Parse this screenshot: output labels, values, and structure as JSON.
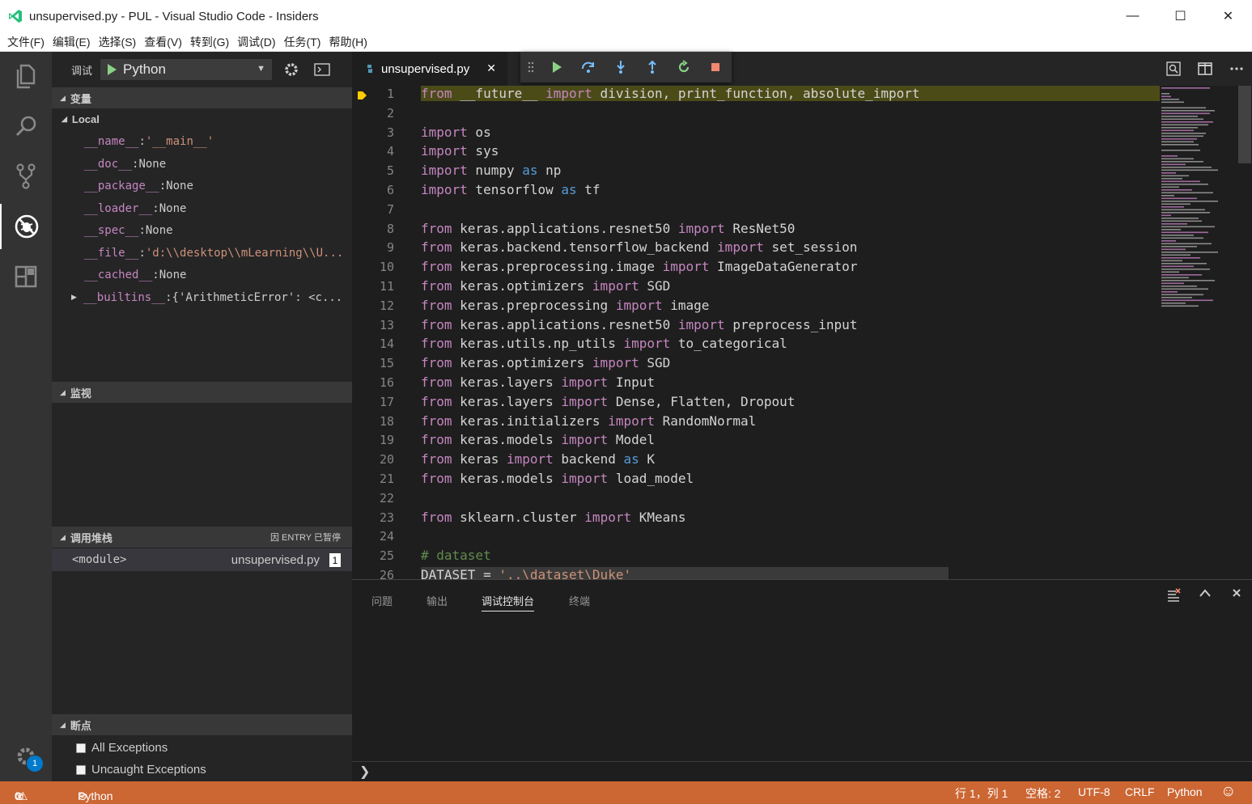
{
  "window": {
    "title": "unsupervised.py - PUL - Visual Studio Code - Insiders",
    "minimize": "—",
    "maximize": "☐",
    "close": "✕"
  },
  "menu": [
    "文件(F)",
    "编辑(E)",
    "选择(S)",
    "查看(V)",
    "转到(G)",
    "调试(D)",
    "任务(T)",
    "帮助(H)"
  ],
  "activity_bar": {
    "icons": [
      "files-icon",
      "search-icon",
      "source-control-icon",
      "debug-icon",
      "extensions-icon",
      "settings-gear-icon"
    ],
    "settings_badge": "1"
  },
  "debug": {
    "label": "调试",
    "configuration": "Python",
    "sections": {
      "variables": "变量",
      "watch": "监视",
      "callstack": "调用堆栈",
      "breakpoints": "断点"
    },
    "scope": "Local",
    "variables": [
      {
        "name": "__name__",
        "value": "'__main__'",
        "is_string": true
      },
      {
        "name": "__doc__",
        "value": "None",
        "is_string": false
      },
      {
        "name": "__package__",
        "value": "None",
        "is_string": false
      },
      {
        "name": "__loader__",
        "value": "None",
        "is_string": false
      },
      {
        "name": "__spec__",
        "value": "None",
        "is_string": false
      },
      {
        "name": "__file__",
        "value": "'d:\\\\desktop\\\\mLearning\\\\U...",
        "is_string": true
      },
      {
        "name": "__cached__",
        "value": "None",
        "is_string": false
      },
      {
        "name": "__builtins__",
        "value": "{'ArithmeticError': <c...",
        "is_string": false
      }
    ],
    "callstack_status": "因 ENTRY 已暂停",
    "callstack_frame": {
      "name": "<module>",
      "file": "unsupervised.py",
      "line": "1"
    },
    "breakpoints": [
      {
        "label": "All Exceptions"
      },
      {
        "label": "Uncaught Exceptions"
      }
    ]
  },
  "editor": {
    "tab": "unsupervised.py",
    "lines": [
      {
        "n": "1",
        "tokens": [
          [
            "from",
            "kw"
          ],
          [
            " __future__ ",
            ""
          ],
          [
            "import",
            "kw"
          ],
          [
            " division, print_function, absolute_import",
            ""
          ]
        ],
        "highlight": true
      },
      {
        "n": "2",
        "tokens": []
      },
      {
        "n": "3",
        "tokens": [
          [
            "import",
            "kw"
          ],
          [
            " os",
            ""
          ]
        ]
      },
      {
        "n": "4",
        "tokens": [
          [
            "import",
            "kw"
          ],
          [
            " sys",
            ""
          ]
        ]
      },
      {
        "n": "5",
        "tokens": [
          [
            "import",
            "kw"
          ],
          [
            " numpy ",
            ""
          ],
          [
            "as",
            "kw2"
          ],
          [
            " np",
            ""
          ]
        ]
      },
      {
        "n": "6",
        "tokens": [
          [
            "import",
            "kw"
          ],
          [
            " tensorflow ",
            ""
          ],
          [
            "as",
            "kw2"
          ],
          [
            " tf",
            ""
          ]
        ]
      },
      {
        "n": "7",
        "tokens": []
      },
      {
        "n": "8",
        "tokens": [
          [
            "from",
            "kw"
          ],
          [
            " keras.applications.resnet50 ",
            ""
          ],
          [
            "import",
            "kw"
          ],
          [
            " ResNet50",
            ""
          ]
        ]
      },
      {
        "n": "9",
        "tokens": [
          [
            "from",
            "kw"
          ],
          [
            " keras.backend.tensorflow_backend ",
            ""
          ],
          [
            "import",
            "kw"
          ],
          [
            " set_session",
            ""
          ]
        ]
      },
      {
        "n": "10",
        "tokens": [
          [
            "from",
            "kw"
          ],
          [
            " keras.preprocessing.image ",
            ""
          ],
          [
            "import",
            "kw"
          ],
          [
            " ImageDataGenerator",
            ""
          ]
        ]
      },
      {
        "n": "11",
        "tokens": [
          [
            "from",
            "kw"
          ],
          [
            " keras.optimizers ",
            ""
          ],
          [
            "import",
            "kw"
          ],
          [
            " SGD",
            ""
          ]
        ]
      },
      {
        "n": "12",
        "tokens": [
          [
            "from",
            "kw"
          ],
          [
            " keras.preprocessing ",
            ""
          ],
          [
            "import",
            "kw"
          ],
          [
            " image",
            ""
          ]
        ]
      },
      {
        "n": "13",
        "tokens": [
          [
            "from",
            "kw"
          ],
          [
            " keras.applications.resnet50 ",
            ""
          ],
          [
            "import",
            "kw"
          ],
          [
            " preprocess_input",
            ""
          ]
        ]
      },
      {
        "n": "14",
        "tokens": [
          [
            "from",
            "kw"
          ],
          [
            " keras.utils.np_utils ",
            ""
          ],
          [
            "import",
            "kw"
          ],
          [
            " to_categorical",
            ""
          ]
        ]
      },
      {
        "n": "15",
        "tokens": [
          [
            "from",
            "kw"
          ],
          [
            " keras.optimizers ",
            ""
          ],
          [
            "import",
            "kw"
          ],
          [
            " SGD",
            ""
          ]
        ]
      },
      {
        "n": "16",
        "tokens": [
          [
            "from",
            "kw"
          ],
          [
            " keras.layers ",
            ""
          ],
          [
            "import",
            "kw"
          ],
          [
            " Input",
            ""
          ]
        ]
      },
      {
        "n": "17",
        "tokens": [
          [
            "from",
            "kw"
          ],
          [
            " keras.layers ",
            ""
          ],
          [
            "import",
            "kw"
          ],
          [
            " Dense, Flatten, Dropout",
            ""
          ]
        ]
      },
      {
        "n": "18",
        "tokens": [
          [
            "from",
            "kw"
          ],
          [
            " keras.initializers ",
            ""
          ],
          [
            "import",
            "kw"
          ],
          [
            " RandomNormal",
            ""
          ]
        ]
      },
      {
        "n": "19",
        "tokens": [
          [
            "from",
            "kw"
          ],
          [
            " keras.models ",
            ""
          ],
          [
            "import",
            "kw"
          ],
          [
            " Model",
            ""
          ]
        ]
      },
      {
        "n": "20",
        "tokens": [
          [
            "from",
            "kw"
          ],
          [
            " keras ",
            ""
          ],
          [
            "import",
            "kw"
          ],
          [
            " backend ",
            ""
          ],
          [
            "as",
            "kw2"
          ],
          [
            " K",
            ""
          ]
        ]
      },
      {
        "n": "21",
        "tokens": [
          [
            "from",
            "kw"
          ],
          [
            " keras.models ",
            ""
          ],
          [
            "import",
            "kw"
          ],
          [
            " load_model",
            ""
          ]
        ]
      },
      {
        "n": "22",
        "tokens": []
      },
      {
        "n": "23",
        "tokens": [
          [
            "from",
            "kw"
          ],
          [
            " sklearn.cluster ",
            ""
          ],
          [
            "import",
            "kw"
          ],
          [
            " KMeans",
            ""
          ]
        ]
      },
      {
        "n": "24",
        "tokens": []
      },
      {
        "n": "25",
        "tokens": [
          [
            "# dataset",
            "cm"
          ]
        ]
      },
      {
        "n": "26",
        "tokens": [
          [
            "DATASET = ",
            ""
          ],
          [
            "'..\\dataset\\Duke'",
            "str"
          ]
        ]
      }
    ]
  },
  "panel": {
    "tabs": [
      "问题",
      "输出",
      "调试控制台",
      "终端"
    ],
    "active_tab": "调试控制台",
    "prompt": "❯"
  },
  "statusbar": {
    "errors": "0",
    "warnings": "0",
    "debug_config": "Python",
    "position": "行 1，列 1",
    "spaces": "空格: 2",
    "encoding": "UTF-8",
    "eol": "CRLF",
    "language": "Python",
    "feedback": "☺"
  },
  "colors": {
    "accent_debug_statusbar": "#cc6633",
    "keyword": "#c586c0",
    "keyword_as": "#569cd6",
    "comment": "#608b4e",
    "string": "#ce9178"
  }
}
